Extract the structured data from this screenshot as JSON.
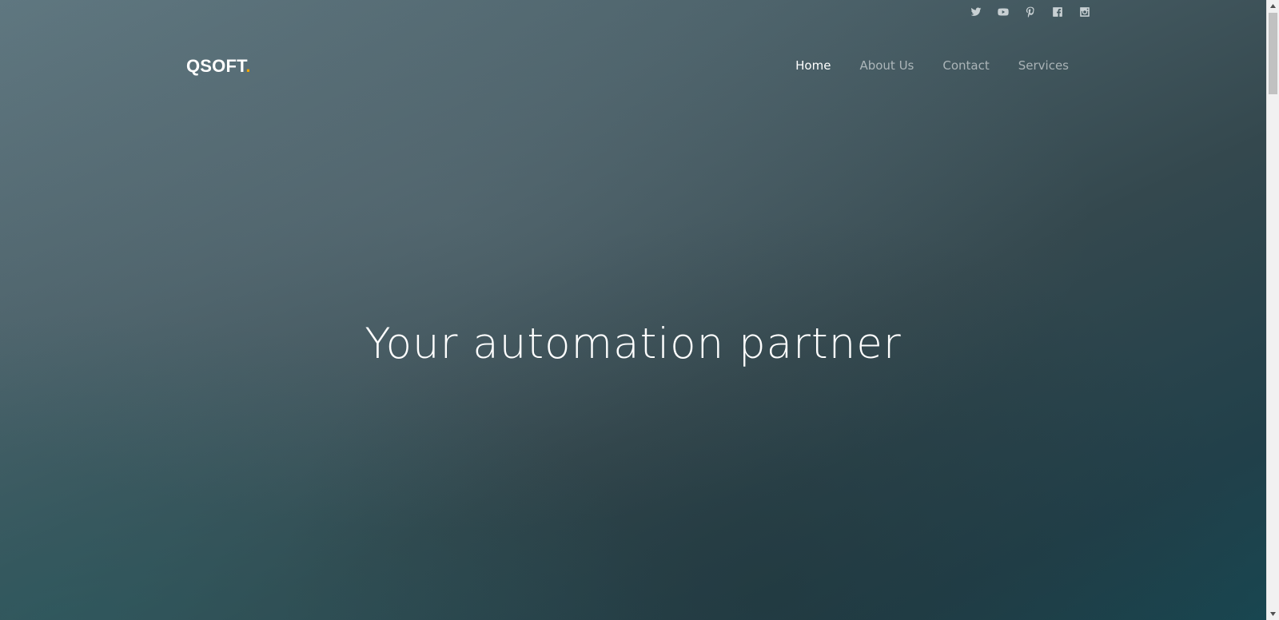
{
  "social": {
    "icons": [
      "twitter-icon",
      "youtube-icon",
      "pinterest-icon",
      "facebook-icon",
      "instagram-icon"
    ],
    "color": "#c8d0d3"
  },
  "header": {
    "logo_text": "QSOFT",
    "logo_dot": ".",
    "logo_accent_color": "#f0a500"
  },
  "nav": {
    "items": [
      {
        "label": "Home",
        "active": true
      },
      {
        "label": "About Us",
        "active": false
      },
      {
        "label": "Contact",
        "active": false
      },
      {
        "label": "Services",
        "active": false
      }
    ]
  },
  "hero": {
    "title": "Your automation partner"
  },
  "colors": {
    "background_top": "#5f7780",
    "background_bottom": "#184650",
    "text": "#ffffff"
  }
}
